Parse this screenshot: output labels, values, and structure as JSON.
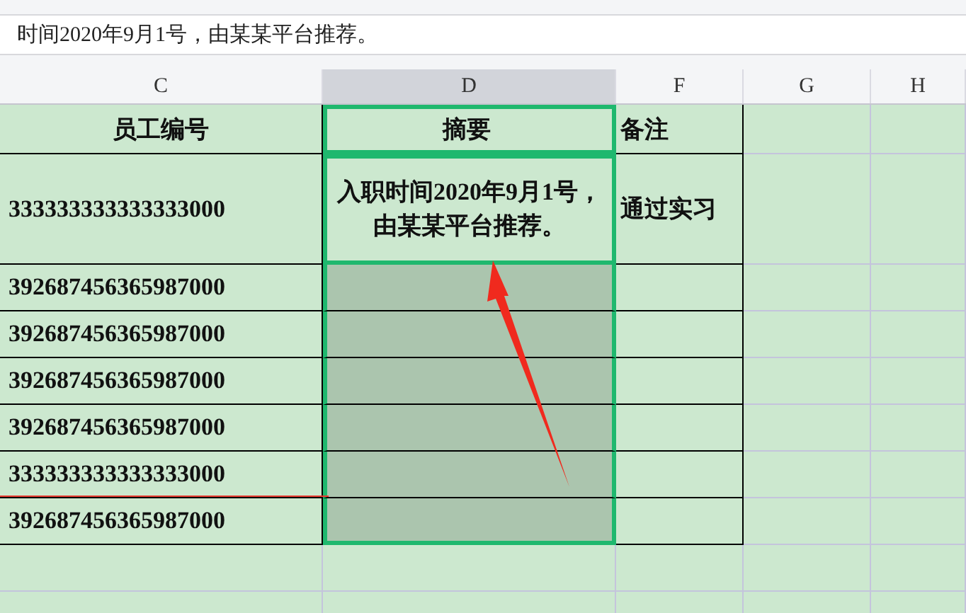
{
  "formula_bar": {
    "value": "时间2020年9月1号，由某某平台推荐。"
  },
  "columns": [
    {
      "letter": "C",
      "selected": false
    },
    {
      "letter": "D",
      "selected": true
    },
    {
      "letter": "F",
      "selected": false
    },
    {
      "letter": "G",
      "selected": false
    },
    {
      "letter": "H",
      "selected": false
    }
  ],
  "rows": [
    {
      "kind": "header",
      "cells": [
        {
          "text": "员工编号",
          "selected": false
        },
        {
          "text": "摘要",
          "selected": true,
          "active": true
        },
        {
          "text": "备注",
          "selected": false
        }
      ]
    },
    {
      "kind": "tall",
      "cells": [
        {
          "text": "333333333333333000",
          "selected": false
        },
        {
          "text": "入职时间2020年9月1号，由某某平台推荐。",
          "selected": true,
          "active": true
        },
        {
          "text": "通过实习",
          "selected": false
        }
      ]
    },
    {
      "kind": "data",
      "cells": [
        {
          "text": "392687456365987000",
          "selected": false
        },
        {
          "selected": true,
          "active": false
        },
        {
          "selected": false
        }
      ]
    },
    {
      "kind": "data",
      "cells": [
        {
          "text": "392687456365987000",
          "selected": false
        },
        {
          "selected": true,
          "active": false
        },
        {
          "selected": false
        }
      ]
    },
    {
      "kind": "data",
      "cells": [
        {
          "text": "392687456365987000",
          "selected": false
        },
        {
          "selected": true,
          "active": false
        },
        {
          "selected": false
        }
      ]
    },
    {
      "kind": "data",
      "cells": [
        {
          "text": "392687456365987000",
          "selected": false
        },
        {
          "selected": true,
          "active": false
        },
        {
          "selected": false
        }
      ]
    },
    {
      "kind": "data",
      "cells": [
        {
          "text": "333333333333333000",
          "selected": false
        },
        {
          "selected": true,
          "active": false
        },
        {
          "selected": false
        }
      ]
    },
    {
      "kind": "data",
      "cells": [
        {
          "text": "392687456365987000",
          "selected": false
        },
        {
          "selected": true,
          "active": false
        },
        {
          "selected": false
        }
      ]
    }
  ]
}
